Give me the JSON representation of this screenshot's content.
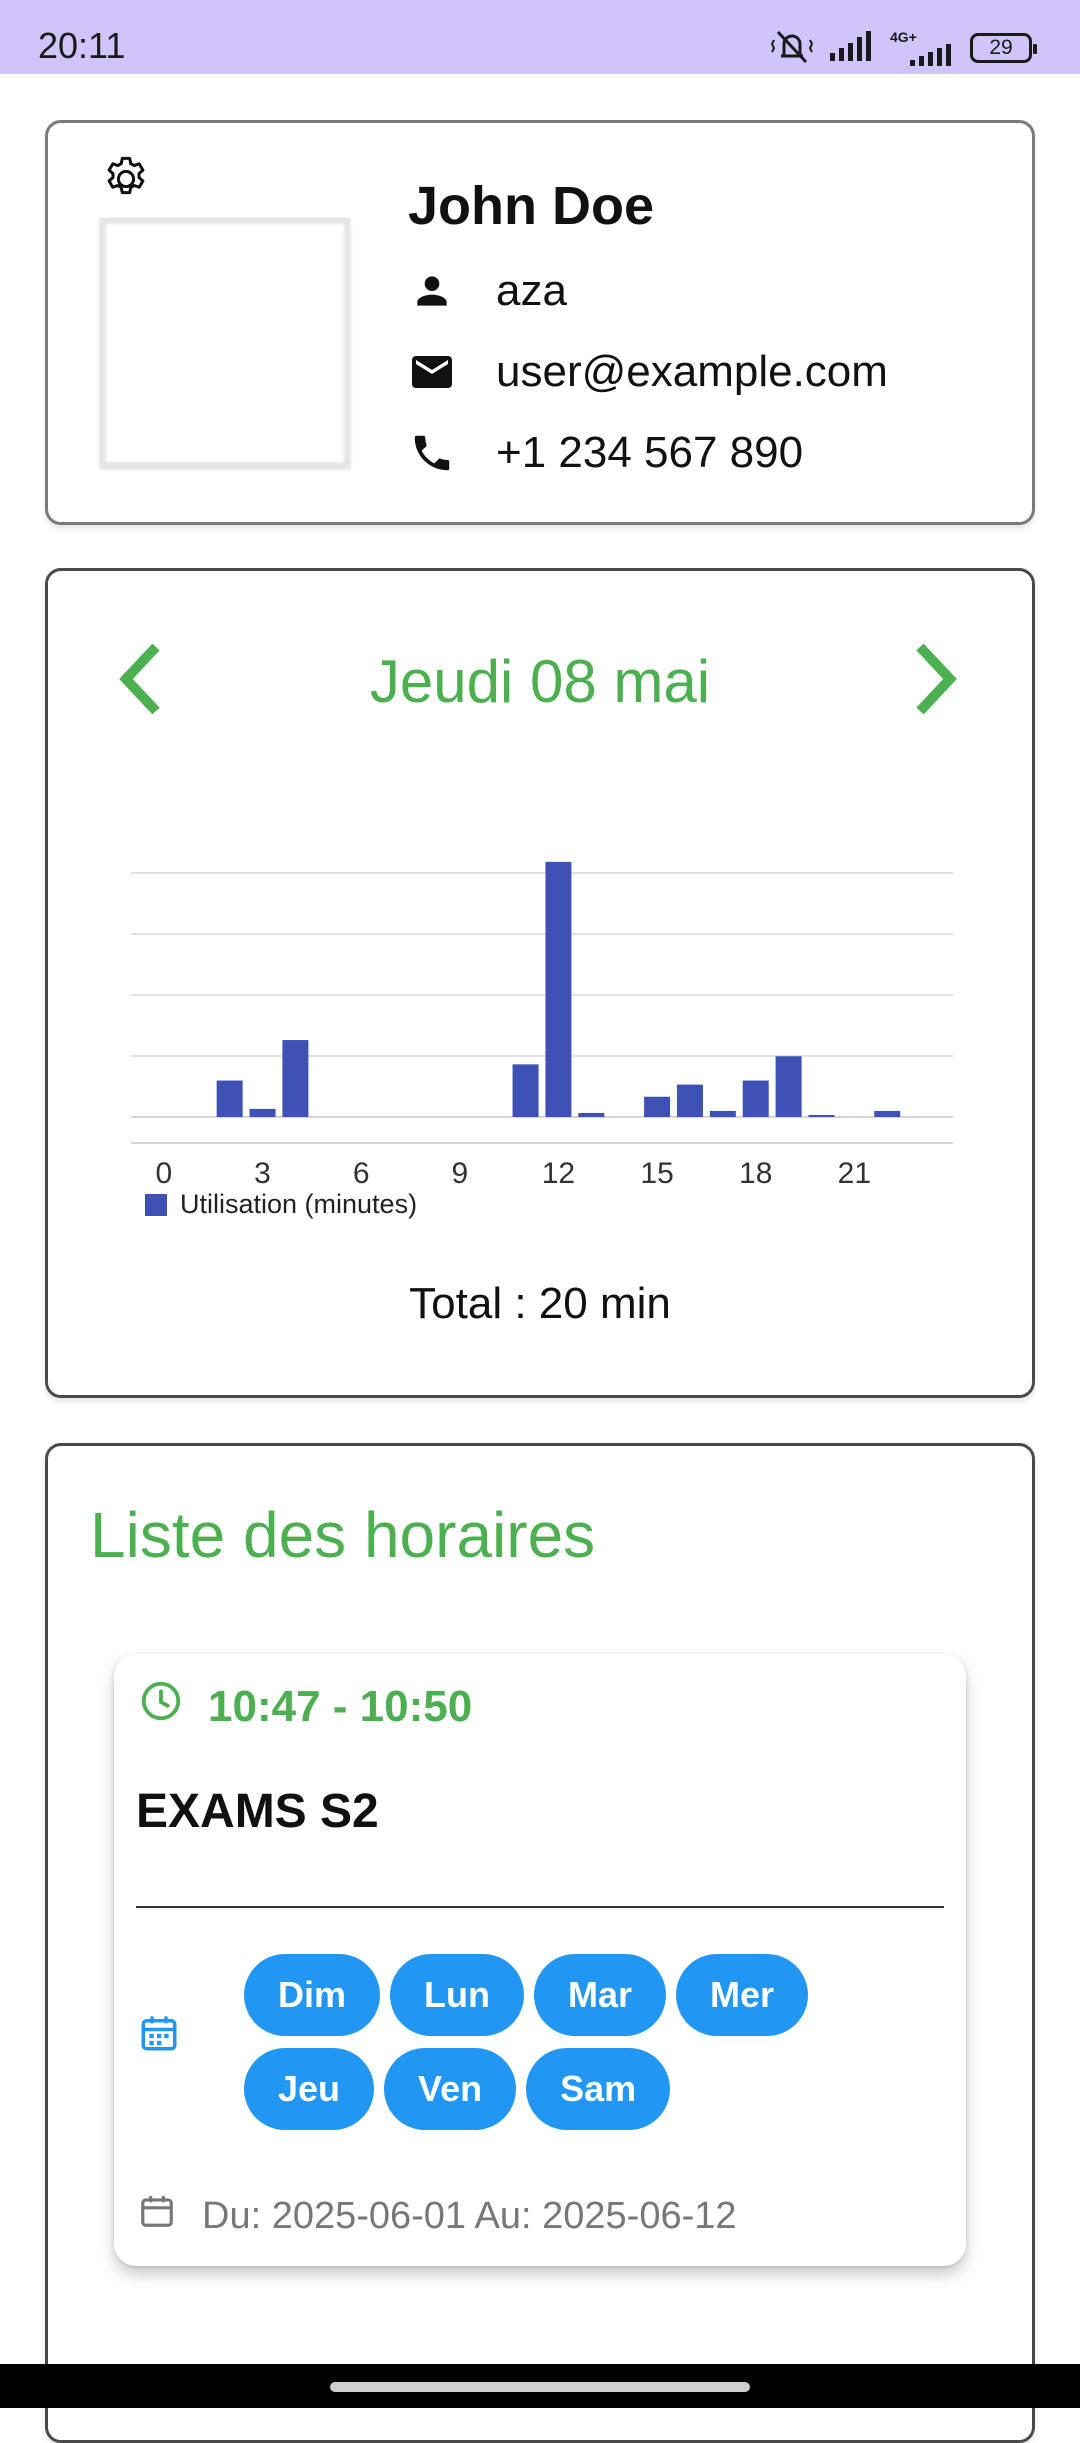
{
  "status_bar": {
    "time": "20:11",
    "network_label": "4G+",
    "battery": "29"
  },
  "profile": {
    "name": "John Doe",
    "username": "aza",
    "email": "user@example.com",
    "phone": "+1 234 567 890"
  },
  "usage": {
    "date_title": "Jeudi 08 mai",
    "total_text": "Total : 20 min"
  },
  "chart_data": {
    "type": "bar",
    "x": [
      2,
      3,
      4,
      11,
      12,
      13,
      15,
      16,
      17,
      18,
      19,
      20,
      22
    ],
    "values": [
      0.9,
      0.2,
      1.9,
      1.3,
      6.3,
      0.1,
      0.5,
      0.8,
      0.15,
      0.9,
      1.5,
      0.05,
      0.15
    ],
    "xticks": [
      "0",
      "3",
      "6",
      "9",
      "12",
      "15",
      "18",
      "21"
    ],
    "xlim": [
      -1,
      24
    ],
    "ylim": [
      0,
      6
    ],
    "legend": "Utilisation (minutes)",
    "legend_position": "bottom-left",
    "grid": true,
    "color": "#3f51b5"
  },
  "schedules": {
    "title": "Liste des horaires",
    "items": [
      {
        "time_range": "10:47 - 10:50",
        "name": "EXAMS S2",
        "days": [
          "Dim",
          "Lun",
          "Mar",
          "Mer",
          "Jeu",
          "Ven",
          "Sam"
        ],
        "dates": "Du: 2025-06-01 Au: 2025-06-12"
      }
    ]
  },
  "colors": {
    "accent_green": "#4caf50",
    "chip_blue": "#2196f3",
    "bar_blue": "#3f51b5",
    "status_bar": "#d1c4fb"
  }
}
